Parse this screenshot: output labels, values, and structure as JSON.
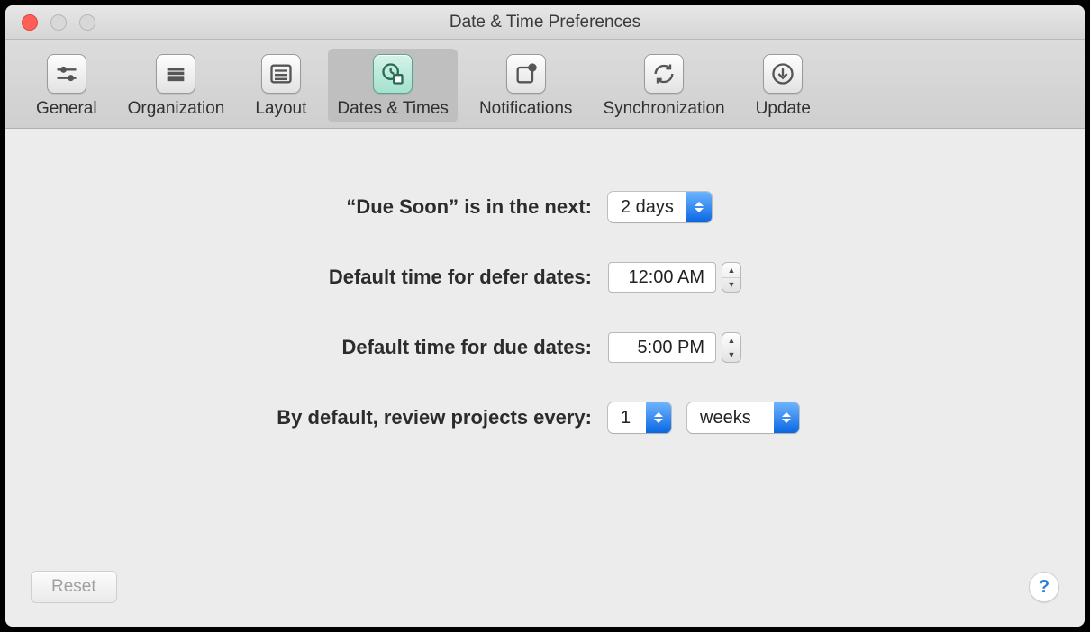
{
  "window": {
    "title": "Date & Time Preferences"
  },
  "toolbar": {
    "items": [
      {
        "id": "general",
        "label": "General"
      },
      {
        "id": "organization",
        "label": "Organization"
      },
      {
        "id": "layout",
        "label": "Layout"
      },
      {
        "id": "dates-times",
        "label": "Dates & Times",
        "selected": true
      },
      {
        "id": "notifications",
        "label": "Notifications"
      },
      {
        "id": "synchronization",
        "label": "Synchronization"
      },
      {
        "id": "update",
        "label": "Update"
      }
    ]
  },
  "form": {
    "due_soon": {
      "label": "“Due Soon” is in the next:",
      "value": "2 days"
    },
    "defer_time": {
      "label": "Default time for defer dates:",
      "value": "12:00 AM"
    },
    "due_time": {
      "label": "Default time for due dates:",
      "value": "5:00 PM"
    },
    "review": {
      "label": "By default, review projects every:",
      "count": "1",
      "unit": "weeks"
    }
  },
  "footer": {
    "reset_label": "Reset",
    "help_label": "?"
  }
}
